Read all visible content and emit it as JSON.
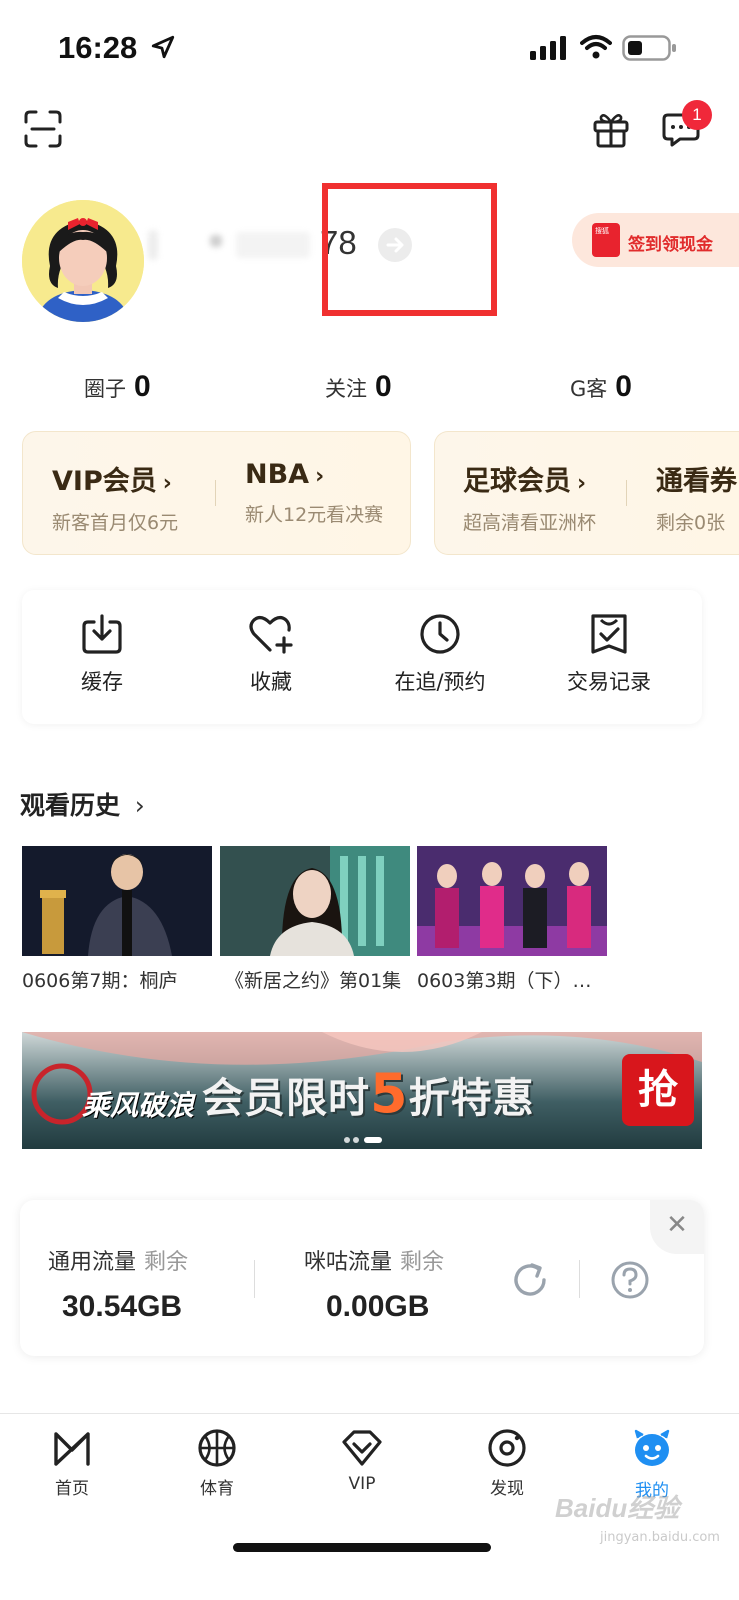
{
  "status_bar": {
    "time": "16:28"
  },
  "header": {
    "message_badge": "1"
  },
  "profile": {
    "username_visible": "78",
    "signin_label": "签到领现金",
    "envelope_text": "搜狐"
  },
  "stats": [
    {
      "label": "圈子",
      "value": "0"
    },
    {
      "label": "关注",
      "value": "0"
    },
    {
      "label": "G客",
      "value": "0"
    }
  ],
  "promos": {
    "card1": [
      {
        "title": "VIP会员",
        "subtitle": "新客首月仅6元"
      },
      {
        "title": "NBA",
        "subtitle": "新人12元看决赛"
      }
    ],
    "card2": [
      {
        "title": "足球会员",
        "subtitle": "超高清看亚洲杯"
      },
      {
        "title": "通看券",
        "subtitle": "剩余0张"
      }
    ]
  },
  "quick_actions": [
    {
      "label": "缓存",
      "icon": "download-icon"
    },
    {
      "label": "收藏",
      "icon": "heart-plus-icon"
    },
    {
      "label": "在追/预约",
      "icon": "clock-icon"
    },
    {
      "label": "交易记录",
      "icon": "receipt-check-icon"
    }
  ],
  "history": {
    "title": "观看历史",
    "items": [
      {
        "caption": "0606第7期：桐庐"
      },
      {
        "caption": "《新居之约》第01集"
      },
      {
        "caption": "0603第3期（下）…"
      }
    ]
  },
  "banner": {
    "brand": "乘风破浪",
    "text_before": "会员限时",
    "highlight": "5",
    "text_after": "折特惠",
    "button": "抢"
  },
  "traffic": {
    "general_label": "通用流量",
    "general_remaining": "剩余",
    "general_value": "30.54GB",
    "migu_label": "咪咕流量",
    "migu_remaining": "剩余",
    "migu_value": "0.00GB"
  },
  "tabbar": [
    {
      "label": "首页",
      "icon": "home-icon",
      "active": false
    },
    {
      "label": "体育",
      "icon": "basketball-icon",
      "active": false
    },
    {
      "label": "VIP",
      "icon": "vip-diamond-icon",
      "active": false
    },
    {
      "label": "发现",
      "icon": "discover-icon",
      "active": false
    },
    {
      "label": "我的",
      "icon": "profile-face-icon",
      "active": true
    }
  ],
  "watermark": {
    "main": "Baidu经验",
    "sub": "jingyan.baidu.com"
  },
  "colors": {
    "accent": "#1f8ff2",
    "badge": "#f0283a",
    "highlight_box": "#f03030",
    "signin_text": "#e12c2c"
  }
}
